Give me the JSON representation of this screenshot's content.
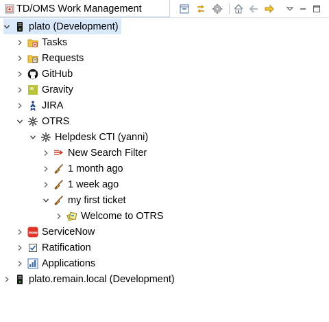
{
  "view": {
    "title": "TD/OMS Work Management",
    "toolbar": [
      {
        "name": "collapse-all-button",
        "icon": "collapse-all-icon"
      },
      {
        "name": "link-with-editor-button",
        "icon": "link-sync-icon"
      },
      {
        "name": "settings-button",
        "icon": "gear-icon"
      },
      {
        "name": "home-button",
        "icon": "home-icon"
      },
      {
        "name": "back-button",
        "icon": "back-arrow-icon"
      },
      {
        "name": "forward-button",
        "icon": "forward-arrow-icon"
      },
      {
        "name": "view-menu-button",
        "icon": "view-menu-icon"
      },
      {
        "name": "minimize-button",
        "icon": "minimize-icon"
      },
      {
        "name": "maximize-button",
        "icon": "maximize-icon"
      }
    ]
  },
  "tree": [
    {
      "label": "plato (Development)",
      "icon": "server-icon",
      "depth": 0,
      "twisty": "expanded",
      "selected": true
    },
    {
      "label": "Tasks",
      "icon": "tasks-folder-icon",
      "depth": 1,
      "twisty": "collapsed"
    },
    {
      "label": "Requests",
      "icon": "requests-folder-icon",
      "depth": 1,
      "twisty": "collapsed"
    },
    {
      "label": "GitHub",
      "icon": "github-icon",
      "depth": 1,
      "twisty": "collapsed"
    },
    {
      "label": "Gravity",
      "icon": "gravity-icon",
      "depth": 1,
      "twisty": "collapsed"
    },
    {
      "label": "JIRA",
      "icon": "jira-icon",
      "depth": 1,
      "twisty": "collapsed"
    },
    {
      "label": "OTRS",
      "icon": "otrs-icon",
      "depth": 1,
      "twisty": "expanded"
    },
    {
      "label": "Helpdesk CTI (yanni)",
      "icon": "otrs-icon",
      "depth": 2,
      "twisty": "expanded"
    },
    {
      "label": "New Search Filter",
      "icon": "search-filter-icon",
      "depth": 3,
      "twisty": "collapsed"
    },
    {
      "label": "1 month ago",
      "icon": "broom-icon",
      "depth": 3,
      "twisty": "collapsed"
    },
    {
      "label": "1 week ago",
      "icon": "broom-icon",
      "depth": 3,
      "twisty": "collapsed"
    },
    {
      "label": "my first ticket",
      "icon": "broom-icon",
      "depth": 3,
      "twisty": "expanded"
    },
    {
      "label": "Welcome to OTRS",
      "icon": "ticket-icon",
      "depth": 4,
      "twisty": "collapsed"
    },
    {
      "label": "ServiceNow",
      "icon": "servicenow-icon",
      "depth": 1,
      "twisty": "collapsed"
    },
    {
      "label": "Ratification",
      "icon": "checkbox-icon",
      "depth": 1,
      "twisty": "collapsed"
    },
    {
      "label": "Applications",
      "icon": "applications-icon",
      "depth": 1,
      "twisty": "collapsed"
    },
    {
      "label": "plato.remain.local (Development)",
      "icon": "server-icon",
      "depth": 0,
      "twisty": "collapsed"
    }
  ]
}
